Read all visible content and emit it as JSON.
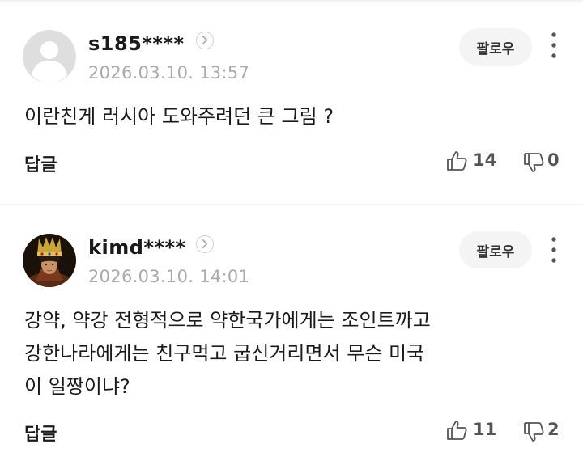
{
  "comments": [
    {
      "username": "s185****",
      "timestamp": "2026.03.10. 13:57",
      "follow_label": "팔로우",
      "avatar": "default-user-avatar",
      "body": "이란친게 러시아 도와주려던 큰 그림 ?",
      "reply_label": "답글",
      "likes": "14",
      "dislikes": "0"
    },
    {
      "username": "kimd****",
      "timestamp": "2026.03.10. 14:01",
      "follow_label": "팔로우",
      "avatar": "photo-avatar-crowned-figure",
      "body": "강약, 약강 전형적으로 약한국가에게는 조인트까고\n강한나라에게는 친구먹고 굽신거리면서 무슨 미국\n이 일짱이냐?",
      "reply_label": "답글",
      "likes": "11",
      "dislikes": "2"
    }
  ],
  "colors": {
    "text": "#1a1a1a",
    "muted": "#aaaaaa",
    "button_bg": "#f4f4f4",
    "divider": "#f1f1f1",
    "icon": "#555555"
  }
}
